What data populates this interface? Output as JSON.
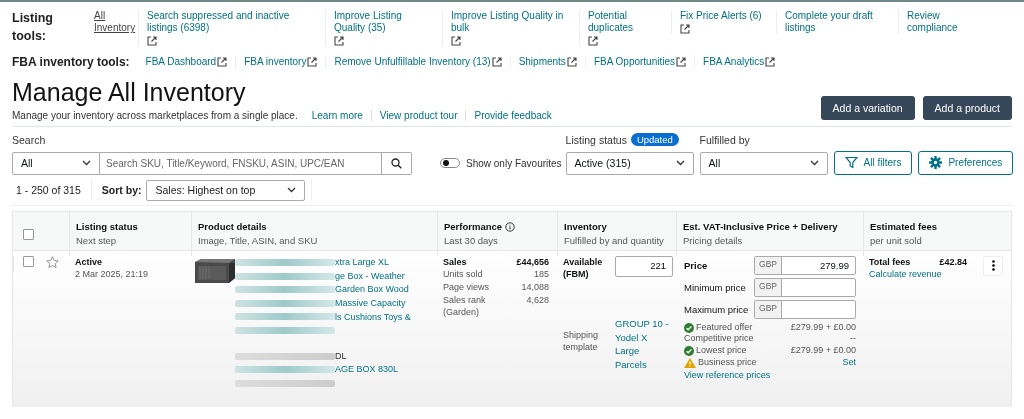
{
  "listing_tools": {
    "label": "Listing tools:",
    "items": [
      {
        "label": "All Inventory",
        "external": false,
        "selected": true
      },
      {
        "label": "Search suppressed and inactive listings (6398)",
        "external": true,
        "selected": false
      },
      {
        "label": "Improve Listing Quality (35)",
        "external": true,
        "selected": false
      },
      {
        "label": "Improve Listing Quality in bulk",
        "external": true,
        "selected": false
      },
      {
        "label": "Potential duplicates",
        "external": true,
        "selected": false
      },
      {
        "label": "Fix Price Alerts (6)",
        "external": true,
        "selected": false
      },
      {
        "label": "Complete your draft listings",
        "external": false,
        "selected": false
      },
      {
        "label": "Review compliance",
        "external": false,
        "selected": false
      }
    ]
  },
  "fba_tools": {
    "label": "FBA inventory tools:",
    "items": [
      {
        "label": "FBA Dashboard",
        "external": true
      },
      {
        "label": "FBA inventory",
        "external": true
      },
      {
        "label": "Remove Unfulfillable Inventory (13)",
        "external": true
      },
      {
        "label": "Shipments",
        "external": true
      },
      {
        "label": "FBA Opportunities",
        "external": true
      },
      {
        "label": "FBA Analytics",
        "external": true
      }
    ]
  },
  "title": "Manage All Inventory",
  "subtitle": "Manage your inventory across marketplaces from a single place.",
  "subtitle_links": [
    "Learn more",
    "View product tour",
    "Provide feedback"
  ],
  "actions": [
    "Add a variation",
    "Add a product"
  ],
  "search": {
    "label": "Search",
    "scope": "All",
    "placeholder": "Search SKU, Title/Keyword, FNSKU, ASIN, UPC/EAN"
  },
  "favourites_toggle": {
    "label": "Show only Favourites",
    "on": false
  },
  "listing_status": {
    "label": "Listing status",
    "badge": "Updated",
    "value": "Active (315)"
  },
  "fulfilled_by": {
    "label": "Fulfilled by",
    "value": "All"
  },
  "filter_buttons": [
    {
      "label": "All filters"
    },
    {
      "label": "Preferences"
    }
  ],
  "results": {
    "count": "1 - 250 of 315",
    "sort_label": "Sort by:",
    "sort_value": "Sales: Highest on top"
  },
  "table": {
    "select_all_checked": false,
    "columns": [
      {
        "title": "Listing status",
        "subtitle": "Next step",
        "info": false
      },
      {
        "title": "Product details",
        "subtitle": "Image, Title, ASIN, and SKU",
        "info": false
      },
      {
        "title": "Performance",
        "subtitle": "Last 30 days",
        "info": true
      },
      {
        "title": "Inventory",
        "subtitle": "Fulfilled by and quantity",
        "info": false
      },
      {
        "title": "Est. VAT-Inclusive Price + Delivery",
        "subtitle": "Pricing details",
        "info": false
      },
      {
        "title": "Estimated fees",
        "subtitle": "per unit sold",
        "info": false
      }
    ],
    "rows": [
      {
        "checked": false,
        "favourite": false,
        "status": "Active",
        "date": "2 Mar 2025, 21:19",
        "product": {
          "image": {
            "kind": "picture"
          },
          "title_lines": [
            "xtra Large XL",
            "ge Box - Weather",
            "Garden Box Wood",
            "Massive Capacity",
            "ls Cushions Toys &"
          ],
          "sku_lines": [
            "DL",
            "AGE BOX 830L"
          ]
        },
        "performance": {
          "sales_label": "Sales",
          "sales": "£44,656",
          "metrics": [
            {
              "label": "Units sold",
              "value": "185"
            },
            {
              "label": "Page views",
              "value": "14,088"
            },
            {
              "label": "Sales rank",
              "value": "4,628"
            }
          ],
          "rank_category": "(Garden)"
        },
        "inventory": {
          "label": "Available (FBM)",
          "quantity": "221",
          "shipping_label": "Shipping template",
          "shipping_value": "GROUP 10 - Yodel X Large Parcels"
        },
        "pricing": {
          "fields": [
            {
              "label": "Price",
              "currency": "GBP",
              "value": "279.99",
              "bold": true
            },
            {
              "label": "Minimum price",
              "currency": "GBP",
              "bold": false
            },
            {
              "label": "Maximum price",
              "currency": "GBP",
              "bold": false
            }
          ],
          "offers": [
            {
              "label": "Featured offer",
              "value": "£279.99 + £0.00",
              "kind": "ok",
              "link": false
            },
            {
              "label": "Competitive price",
              "value": "--",
              "kind": "plain",
              "link": false
            },
            {
              "label": "Lowest price",
              "value": "£279.99 + £0.00",
              "kind": "ok",
              "link": false
            },
            {
              "label": "Business price",
              "value": "Set",
              "kind": "warning",
              "link": true
            }
          ],
          "reference_link": "View reference prices"
        },
        "fees": {
          "label": "Total fees",
          "value": "£42.84",
          "link": "Calculate revenue"
        }
      }
    ]
  }
}
